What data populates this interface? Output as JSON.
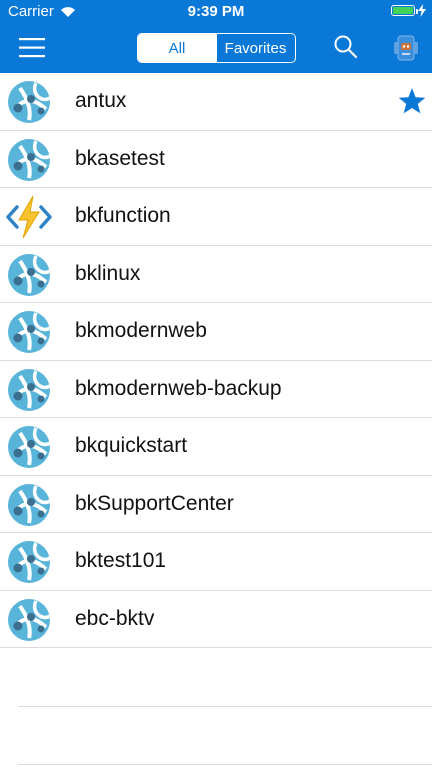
{
  "status_bar": {
    "carrier": "Carrier",
    "time": "9:39 PM"
  },
  "header": {
    "segments": [
      "All",
      "Favorites"
    ],
    "selected_segment": "All",
    "accent_color": "#0a78d7"
  },
  "apps": [
    {
      "name": "antux",
      "icon": "azure-web-app-icon",
      "favorite": true
    },
    {
      "name": "bkasetest",
      "icon": "azure-web-app-icon",
      "favorite": false
    },
    {
      "name": "bkfunction",
      "icon": "azure-function-icon",
      "favorite": false
    },
    {
      "name": "bklinux",
      "icon": "azure-web-app-icon",
      "favorite": false
    },
    {
      "name": "bkmodernweb",
      "icon": "azure-web-app-icon",
      "favorite": false
    },
    {
      "name": "bkmodernweb-backup",
      "icon": "azure-web-app-icon",
      "favorite": false
    },
    {
      "name": "bkquickstart",
      "icon": "azure-web-app-icon",
      "favorite": false
    },
    {
      "name": "bkSupportCenter",
      "icon": "azure-web-app-icon",
      "favorite": false
    },
    {
      "name": "bktest101",
      "icon": "azure-web-app-icon",
      "favorite": false
    },
    {
      "name": "ebc-bktv",
      "icon": "azure-web-app-icon",
      "favorite": false
    }
  ]
}
